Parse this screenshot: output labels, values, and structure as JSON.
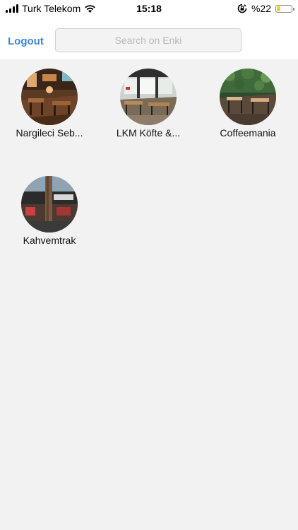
{
  "status_bar": {
    "carrier": "Turk Telekom",
    "time": "15:18",
    "battery_text": "%22",
    "battery_level": 0.22,
    "battery_color": "#f4cf22",
    "icons": [
      "signal-bars-icon",
      "wifi-icon",
      "orientation-lock-icon",
      "battery-icon"
    ]
  },
  "nav": {
    "logout_label": "Logout",
    "search_placeholder": "Search on Enki",
    "search_value": "",
    "accent_color": "#3b86d6"
  },
  "venues": [
    {
      "name": "Nargileci Seb..."
    },
    {
      "name": "LKM Köfte &..."
    },
    {
      "name": "Coffeemania"
    },
    {
      "name": "Kahvemtrak"
    }
  ]
}
